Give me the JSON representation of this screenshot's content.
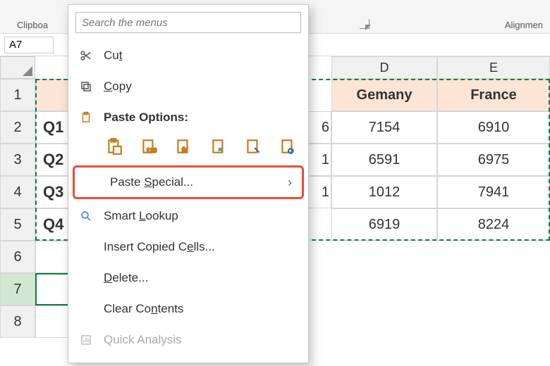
{
  "ribbon": {
    "clipboard_label": "Clipboa",
    "alignment_label": "Alignmen"
  },
  "namebox": {
    "value": "A7"
  },
  "context_menu": {
    "search_placeholder": "Search the menus",
    "cut": "Cut",
    "copy": "Copy",
    "paste_options": "Paste Options:",
    "paste_special": "Paste Special...",
    "smart_lookup": "Smart Lookup",
    "insert_copied_cells": "Insert Copied Cells...",
    "delete": "Delete...",
    "clear_contents": "Clear Contents",
    "quick_analysis": "Quick Analysis",
    "paste_option_icons": [
      "paste",
      "paste-values",
      "paste-formulas",
      "paste-transpose",
      "paste-formatting",
      "paste-link"
    ]
  },
  "columns": {
    "D": "D",
    "E": "E"
  },
  "rows": {
    "r1": "1",
    "r2": "2",
    "r3": "3",
    "r4": "4",
    "r5": "5",
    "r6": "6",
    "r7": "7",
    "r8": "8"
  },
  "cells": {
    "A2": "Q1",
    "A3": "Q2",
    "A4": "Q3",
    "A5": "Q4",
    "C2_partial": "6",
    "C3_partial": "1",
    "C4_partial": "1",
    "C5_partial": "",
    "D1": "Gemany",
    "E1": "France",
    "D2": "7154",
    "E2": "6910",
    "D3": "6591",
    "E3": "6975",
    "D4": "1012",
    "E4": "7941",
    "D5": "6919",
    "E5": "8224"
  }
}
